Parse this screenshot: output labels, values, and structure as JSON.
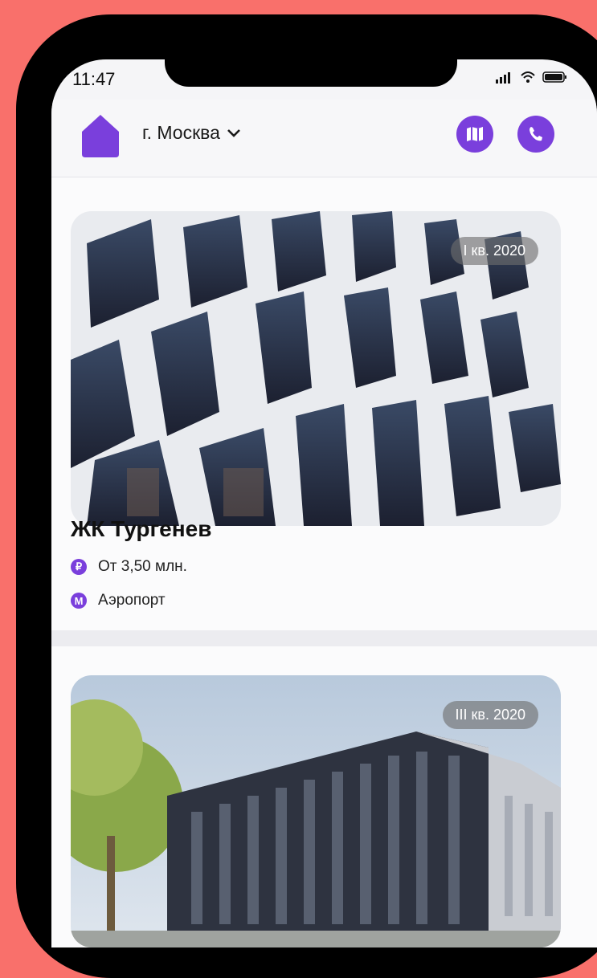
{
  "status_bar": {
    "time": "11:47"
  },
  "header": {
    "city": "г. Москва",
    "map_button_icon": "map-icon",
    "phone_button_icon": "phone-icon",
    "accent": "#7a3fdc"
  },
  "listings": [
    {
      "name": "ЖК Тургенев",
      "price": "От 3,50 млн.",
      "metro": "Аэропорт",
      "badge": "I кв. 2020"
    },
    {
      "badge": "III кв. 2020"
    }
  ]
}
